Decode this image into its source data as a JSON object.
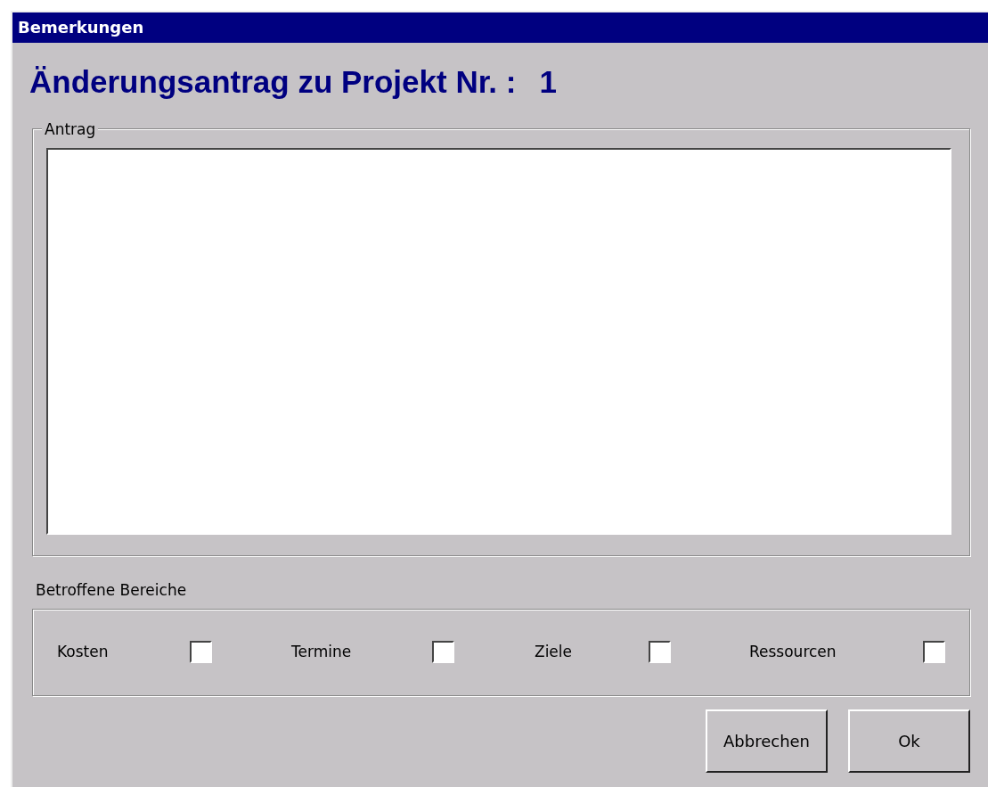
{
  "window": {
    "title": "Bemerkungen"
  },
  "heading": {
    "text": "Änderungsantrag zu Projekt Nr. :",
    "project_number": "1"
  },
  "request_group": {
    "legend": "Antrag"
  },
  "areas": {
    "label": "Betroffene Bereiche",
    "items": [
      {
        "label": "Kosten",
        "checked": false
      },
      {
        "label": "Termine",
        "checked": false
      },
      {
        "label": "Ziele",
        "checked": false
      },
      {
        "label": "Ressourcen",
        "checked": false
      }
    ]
  },
  "buttons": [
    {
      "label": "Abbrechen"
    },
    {
      "label": "Ok"
    }
  ]
}
